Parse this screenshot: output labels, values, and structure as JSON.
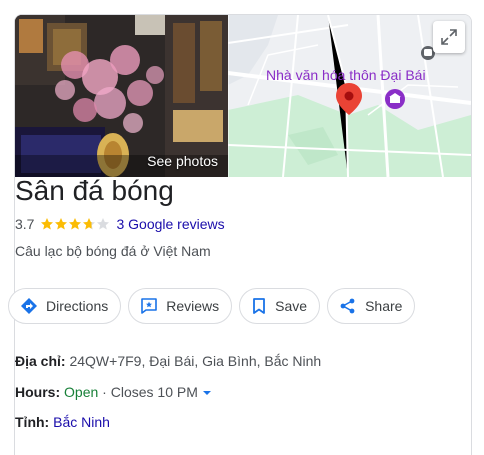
{
  "photo": {
    "label": "See photos"
  },
  "map": {
    "place_label": "Nhà văn hóa thôn Đại Bái"
  },
  "place": {
    "name": "Sân đá bóng",
    "rating": "3.7",
    "rating_value": 3.7,
    "reviews": "3 Google reviews",
    "category": "Câu lạc bộ bóng đá ở Việt Nam"
  },
  "actions": {
    "directions": "Directions",
    "reviews": "Reviews",
    "save": "Save",
    "share": "Share"
  },
  "details": {
    "address_label": "Địa chỉ:",
    "address_value": "24QW+7F9, Đại Bái, Gia Bình, Bắc Ninh",
    "hours_label": "Hours:",
    "hours_status": "Open",
    "hours_sep": "·",
    "hours_close": "Closes 10 PM",
    "province_label": "Tỉnh:",
    "province_value": "Bắc Ninh"
  },
  "colors": {
    "star": "#fbbc04",
    "link": "#1a0dab",
    "open": "#188038",
    "directions": "#1a73e8",
    "pin": "#ea4335",
    "map_landmark": "#8a2ec7"
  }
}
